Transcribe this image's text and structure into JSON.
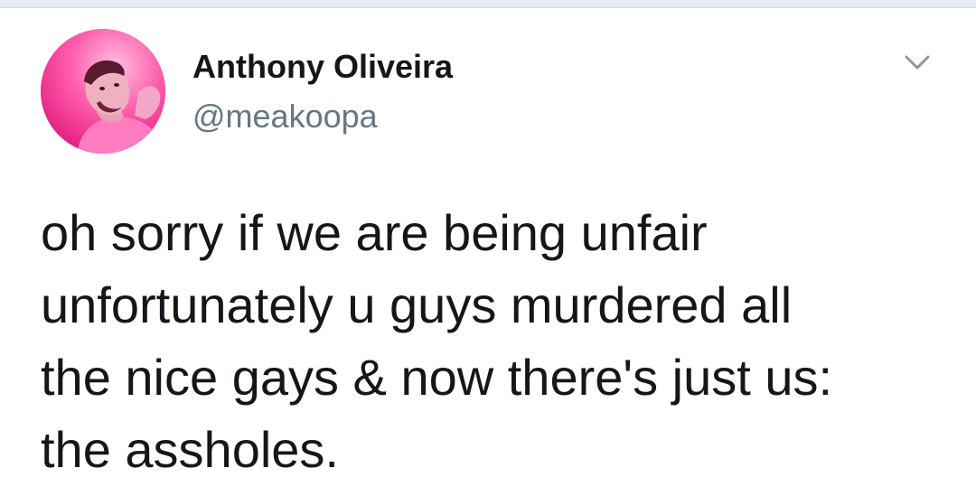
{
  "user": {
    "display_name": "Anthony Oliveira",
    "handle": "@meakoopa",
    "avatar_icon": "profile-photo"
  },
  "tweet": {
    "lines": [
      "oh sorry if we are being unfair",
      "unfortunately u guys murdered all",
      "the nice gays & now there's just us:",
      "the assholes."
    ]
  },
  "menu": {
    "icon": "chevron-down-icon"
  },
  "colors": {
    "text_primary": "#14171a",
    "text_secondary": "#657786",
    "avatar_bg": "#ff4fa6",
    "divider": "#e6ecf0"
  }
}
